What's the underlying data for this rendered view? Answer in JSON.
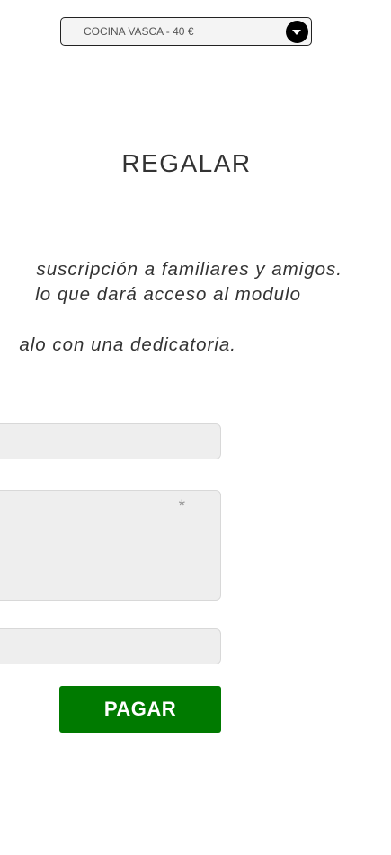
{
  "product_select": {
    "selected_value": "COCINA VASCA - 40 €",
    "arrow_icon": "chevron-down-icon"
  },
  "section": {
    "heading": "REGALAR",
    "description_lines": [
      "suscripción a familiares y amigos.",
      "lo que dará acceso al modulo",
      "alo con una dedicatoria."
    ]
  },
  "form": {
    "message_placeholder_visible": "*",
    "pay_button_label": "PAGAR"
  },
  "colors": {
    "pay_button": "#007a00",
    "field_background": "#eeeeee"
  }
}
